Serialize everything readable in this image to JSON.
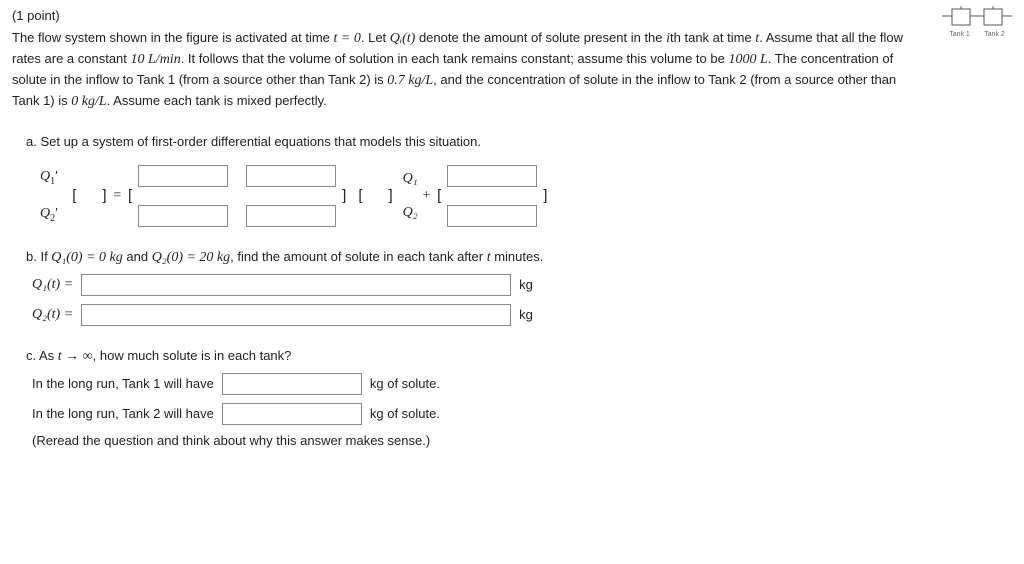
{
  "points_label": "(1 point)",
  "problem": {
    "line1_a": "The flow system shown in the figure is activated at time ",
    "line1_t0": "t = 0",
    "line1_b": ". Let ",
    "line1_q": "Qᵢ(t)",
    "line1_c": " denote the amount of solute present in the ",
    "line1_i": "i",
    "line1_d": "th tank at time ",
    "line1_tt": "t",
    "line1_e": ". Assume that all the flow rates are a constant ",
    "rate": "10 L/min",
    "line1_f": ". It follows that the volume of solution in each tank remains constant; assume this volume to be ",
    "volume": "1000 L",
    "line2_a": ". The concentration of solute in the inflow to Tank 1 (from a source other than Tank 2) is ",
    "conc1": "0.7 kg/L",
    "line2_b": ", and the concentration of solute in the inflow to Tank 2 (from a source other than Tank 1) is ",
    "conc2": "0 kg/L",
    "line2_c": ". Assume each tank is mixed perfectly."
  },
  "diagram": {
    "tank1": "Tank 1",
    "tank2": "Tank 2"
  },
  "part_a": {
    "label": "a. Set up a system of first-order differential equations that models this situation.",
    "lhs": {
      "row1": "Q₁",
      "row2": "Q₂"
    },
    "rhs_vec": {
      "row1": "Q₁",
      "row2": "Q₂"
    },
    "br_open": "[",
    "br_close": "]",
    "eq": " = ",
    "plus": " + "
  },
  "part_b": {
    "label_a": "b. If ",
    "ic1_lhs": "Q₁(0) = 0 kg",
    "and": " and ",
    "ic2_lhs": "Q₂(0) = 20 kg",
    "label_b": ", find the amount of solute in each tank after ",
    "tmin": "t",
    "label_c": " minutes.",
    "q1": "Q₁(t) =",
    "q2": "Q₂(t) =",
    "unit": "kg"
  },
  "part_c": {
    "label_a": "c. As ",
    "limit": "t → ∞",
    "label_b": ", how much solute is in each tank?",
    "line1_a": "In the long run, Tank 1 will have",
    "line1_b": "kg of solute.",
    "line2_a": "In the long run, Tank 2 will have",
    "line2_b": "kg of solute.",
    "note": "(Reread the question and think about why this answer makes sense.)"
  }
}
